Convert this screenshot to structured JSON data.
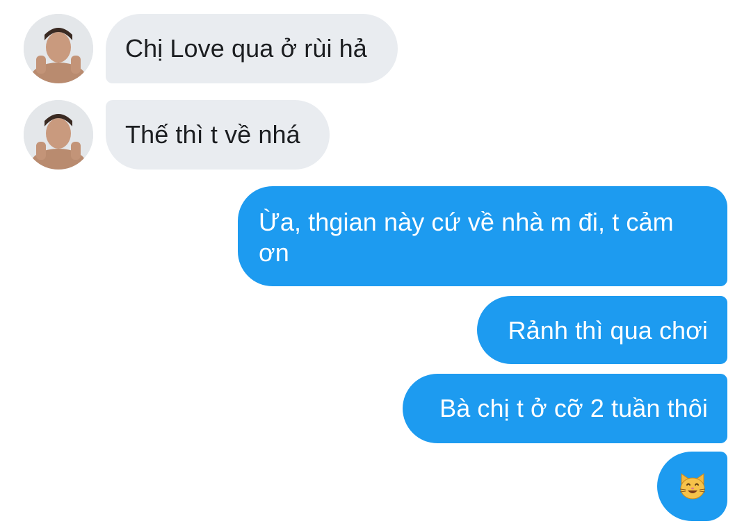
{
  "conversation": {
    "incoming": [
      {
        "text": "Chị Love qua ở rùi hả",
        "avatar": "profile-photo"
      },
      {
        "text": "Thế thì t về nhá",
        "avatar": "profile-photo"
      }
    ],
    "outgoing": [
      {
        "text": "Ừa, thgian này cứ về nhà m đi, t cảm ơn"
      },
      {
        "text": "Rảnh thì qua chơi"
      },
      {
        "text": "Bà chị t ở cỡ 2 tuần thôi"
      },
      {
        "text": "",
        "emoji": "smiling-cat-icon"
      }
    ]
  },
  "colors": {
    "incoming_bubble": "#e9ecf0",
    "outgoing_bubble": "#1d9bf0",
    "incoming_text": "#1c1e21",
    "outgoing_text": "#ffffff"
  }
}
